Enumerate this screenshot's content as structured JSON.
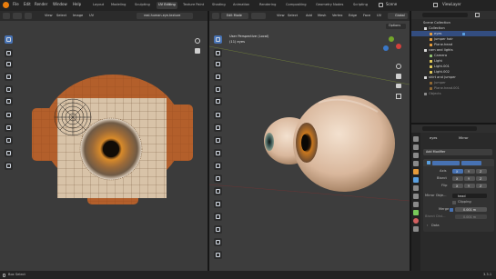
{
  "topbar": {
    "menus": [
      "File",
      "Edit",
      "Render",
      "Window",
      "Help"
    ],
    "workspaces": [
      "Layout",
      "Modeling",
      "Sculpting",
      "UV Editing",
      "Texture Paint",
      "Shading",
      "Animation",
      "Rendering",
      "Compositing",
      "Geometry Nodes",
      "Scripting"
    ],
    "active_workspace": "UV Editing",
    "scene": "Scene",
    "view_layer": "ViewLayer"
  },
  "uv_editor": {
    "menus": [
      "View",
      "Select",
      "Image",
      "UV"
    ],
    "image_name": "real-human-eye-texture"
  },
  "viewport": {
    "mode": "Edit Mode",
    "menus": [
      "View",
      "Select",
      "Add",
      "Mesh",
      "Vertex",
      "Edge",
      "Face",
      "UV"
    ],
    "transform": "Global",
    "options": "Options",
    "view_name": "User Perspective (Local)",
    "object_label": "(11) eyes"
  },
  "outliner": {
    "items": [
      {
        "label": "Scene Collection",
        "depth": 0
      },
      {
        "label": "Collection",
        "depth": 1
      },
      {
        "label": "eyes",
        "depth": 2,
        "selected": true
      },
      {
        "label": "jumper hair",
        "depth": 2
      },
      {
        "label": "Plane.head",
        "depth": 2
      },
      {
        "label": "cam and lights",
        "depth": 1
      },
      {
        "label": "Camera",
        "depth": 2
      },
      {
        "label": "Light",
        "depth": 2
      },
      {
        "label": "Light.001",
        "depth": 2
      },
      {
        "label": "Light.002",
        "depth": 2
      },
      {
        "label": "shirt and jumper",
        "depth": 1
      },
      {
        "label": "jumper",
        "depth": 2
      },
      {
        "label": "Plane.head.001",
        "depth": 2
      },
      {
        "label": "Objects",
        "depth": 1
      }
    ]
  },
  "properties": {
    "object_name": "eyes",
    "modifier_name": "Mirror",
    "add_modifier": "Add Modifier",
    "axis_label": "Axis",
    "bisect_label": "Bisect",
    "flip_label": "Flip",
    "axes": [
      "X",
      "Y",
      "Z"
    ],
    "mirror_object_label": "Mirror Obje...",
    "mirror_object_value": "head",
    "clipping_label": "Clipping",
    "merge_label": "Merge",
    "merge_value": "0.001 m",
    "bisect_distance_label": "Bisect Dist...",
    "bisect_distance_value": "0.001 m",
    "data_section": "Data"
  },
  "statusbar": {
    "left": "Box Select",
    "version": "3.3.1"
  }
}
